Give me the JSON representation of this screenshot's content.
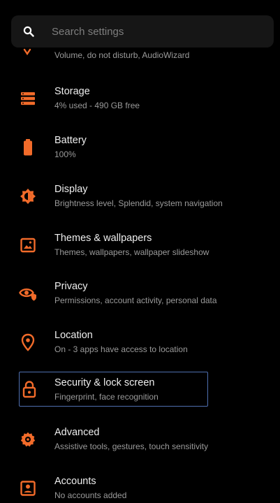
{
  "search": {
    "placeholder": "Search settings"
  },
  "partial_item": {
    "subtitle": "Volume, do not disturb, AudioWizard",
    "icon": "sound-icon"
  },
  "items": [
    {
      "title": "Storage",
      "subtitle": "4% used - 490 GB free",
      "icon": "storage-icon"
    },
    {
      "title": "Battery",
      "subtitle": "100%",
      "icon": "battery-icon"
    },
    {
      "title": "Display",
      "subtitle": "Brightness level, Splendid, system navigation",
      "icon": "display-icon"
    },
    {
      "title": "Themes & wallpapers",
      "subtitle": "Themes, wallpapers, wallpaper slideshow",
      "icon": "wallpaper-icon"
    },
    {
      "title": "Privacy",
      "subtitle": "Permissions, account activity, personal data",
      "icon": "privacy-icon"
    },
    {
      "title": "Location",
      "subtitle": "On - 3 apps have access to location",
      "icon": "location-icon"
    },
    {
      "title": "Security & lock screen",
      "subtitle": "Fingerprint, face recognition",
      "icon": "lock-icon"
    },
    {
      "title": "Advanced",
      "subtitle": "Assistive tools, gestures, touch sensitivity",
      "icon": "gear-icon"
    },
    {
      "title": "Accounts",
      "subtitle": "No accounts added",
      "icon": "account-icon"
    }
  ],
  "colors": {
    "accent": "#f26b2a",
    "background": "#000000",
    "focus_border": "#4f6fb0"
  }
}
